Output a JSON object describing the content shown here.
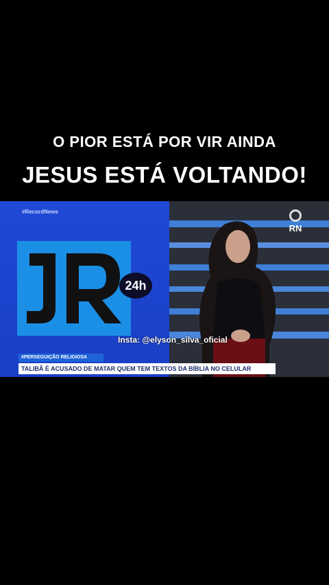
{
  "caption": {
    "line1": "O PIOR ESTÁ POR VIR AINDA",
    "line2": "JESUS ESTÁ VOLTANDO!"
  },
  "video": {
    "channel_tag": "#RecordNews",
    "show_logo_badge": "24h",
    "network_logo": "RN",
    "watermark": "Insta: @elyson_silva_oficial",
    "lower_third_tag": "#PERSEGUIÇÃO RELIGIOSA",
    "headline": "TALIBÃ É ACUSADO DE MATAR QUEM TEM TEXTOS DA BÍBLIA NO CELULAR"
  },
  "colors": {
    "background": "#000000",
    "studio_blue": "#1f49d6",
    "logo_cyan": "#1b8fe6",
    "lower_third_blue": "#1f63d8"
  }
}
